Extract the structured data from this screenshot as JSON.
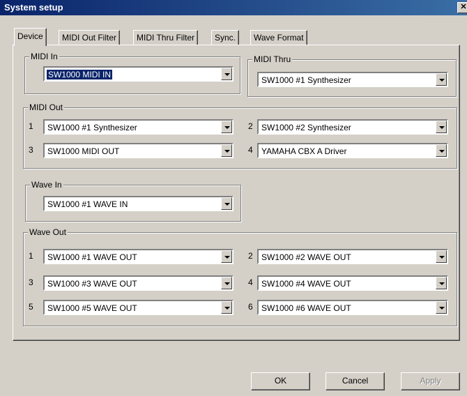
{
  "window": {
    "title": "System setup",
    "close_glyph": "✕"
  },
  "tabs": [
    "Device",
    "MIDI Out Filter",
    "MIDI Thru Filter",
    "Sync.",
    "Wave Format"
  ],
  "midi_in": {
    "label": "MIDI In",
    "value": "SW1000  MIDI IN"
  },
  "midi_thru": {
    "label": "MIDI Thru",
    "value": "SW1000 #1 Synthesizer"
  },
  "midi_out": {
    "label": "MIDI Out",
    "ports": [
      {
        "num": "1",
        "value": "SW1000 #1 Synthesizer"
      },
      {
        "num": "2",
        "value": "SW1000 #2 Synthesizer"
      },
      {
        "num": "3",
        "value": "SW1000  MIDI OUT"
      },
      {
        "num": "4",
        "value": "YAMAHA CBX A Driver"
      }
    ]
  },
  "wave_in": {
    "label": "Wave In",
    "value": "SW1000 #1 WAVE IN"
  },
  "wave_out": {
    "label": "Wave Out",
    "ports": [
      {
        "num": "1",
        "value": "SW1000 #1 WAVE OUT"
      },
      {
        "num": "2",
        "value": "SW1000 #2 WAVE OUT"
      },
      {
        "num": "3",
        "value": "SW1000 #3 WAVE OUT"
      },
      {
        "num": "4",
        "value": "SW1000 #4 WAVE OUT"
      },
      {
        "num": "5",
        "value": "SW1000 #5 WAVE OUT"
      },
      {
        "num": "6",
        "value": "SW1000 #6 WAVE OUT"
      }
    ]
  },
  "buttons": {
    "ok": "OK",
    "cancel": "Cancel",
    "apply": "Apply"
  }
}
